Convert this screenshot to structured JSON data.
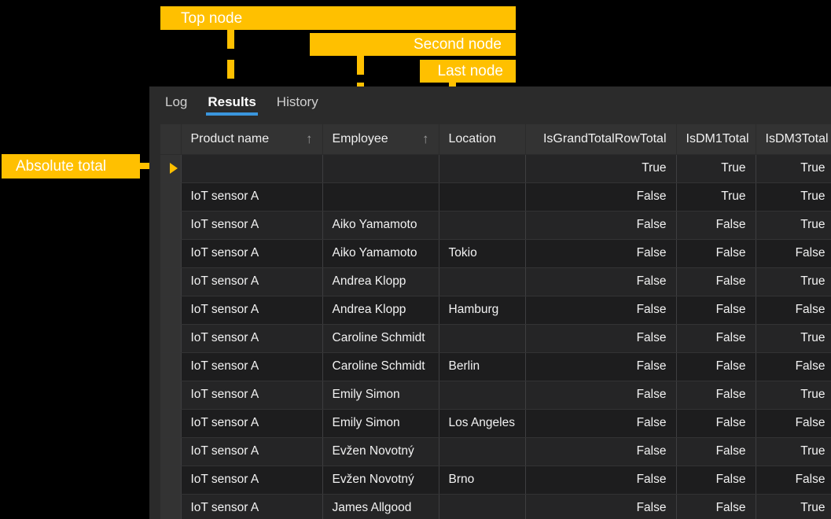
{
  "annotations": {
    "top_node": "Top node",
    "second_node": "Second node",
    "last_node": "Last node",
    "absolute_total": "Absolute total"
  },
  "colors": {
    "accent_yellow": "#ffc000",
    "tab_underline_blue": "#3a96dd",
    "window_bg": "#2b2b2b",
    "header_bg": "#333333",
    "row_odd": "#252526",
    "row_even": "#1d1d1e"
  },
  "tabs": [
    {
      "label": "Log",
      "active": false
    },
    {
      "label": "Results",
      "active": true
    },
    {
      "label": "History",
      "active": false
    }
  ],
  "grid": {
    "columns": [
      {
        "label": "Product name",
        "sort": "ascending",
        "align": "left"
      },
      {
        "label": "Employee",
        "sort": "ascending",
        "align": "left"
      },
      {
        "label": "Location",
        "sort": null,
        "align": "left"
      },
      {
        "label": "IsGrandTotalRowTotal",
        "sort": null,
        "align": "right"
      },
      {
        "label": "IsDM1Total",
        "sort": null,
        "align": "right"
      },
      {
        "label": "IsDM3Total",
        "sort": null,
        "align": "right"
      }
    ],
    "sort_arrow_glyph": "↑",
    "selected_row_index": 0,
    "rows": [
      {
        "product": "",
        "employee": "",
        "location": "",
        "gtr": "True",
        "dm1": "True",
        "dm3": "True"
      },
      {
        "product": "IoT sensor A",
        "employee": "",
        "location": "",
        "gtr": "False",
        "dm1": "True",
        "dm3": "True"
      },
      {
        "product": "IoT sensor A",
        "employee": "Aiko Yamamoto",
        "location": "",
        "gtr": "False",
        "dm1": "False",
        "dm3": "True"
      },
      {
        "product": "IoT sensor A",
        "employee": "Aiko Yamamoto",
        "location": "Tokio",
        "gtr": "False",
        "dm1": "False",
        "dm3": "False"
      },
      {
        "product": "IoT sensor A",
        "employee": "Andrea Klopp",
        "location": "",
        "gtr": "False",
        "dm1": "False",
        "dm3": "True"
      },
      {
        "product": "IoT sensor A",
        "employee": "Andrea Klopp",
        "location": "Hamburg",
        "gtr": "False",
        "dm1": "False",
        "dm3": "False"
      },
      {
        "product": "IoT sensor A",
        "employee": "Caroline Schmidt",
        "location": "",
        "gtr": "False",
        "dm1": "False",
        "dm3": "True"
      },
      {
        "product": "IoT sensor A",
        "employee": "Caroline Schmidt",
        "location": "Berlin",
        "gtr": "False",
        "dm1": "False",
        "dm3": "False"
      },
      {
        "product": "IoT sensor A",
        "employee": "Emily Simon",
        "location": "",
        "gtr": "False",
        "dm1": "False",
        "dm3": "True"
      },
      {
        "product": "IoT sensor A",
        "employee": "Emily Simon",
        "location": "Los Angeles",
        "gtr": "False",
        "dm1": "False",
        "dm3": "False"
      },
      {
        "product": "IoT sensor A",
        "employee": "Evžen Novotný",
        "location": "",
        "gtr": "False",
        "dm1": "False",
        "dm3": "True"
      },
      {
        "product": "IoT sensor A",
        "employee": "Evžen Novotný",
        "location": "Brno",
        "gtr": "False",
        "dm1": "False",
        "dm3": "False"
      },
      {
        "product": "IoT sensor A",
        "employee": "James Allgood",
        "location": "",
        "gtr": "False",
        "dm1": "False",
        "dm3": "True"
      }
    ]
  }
}
